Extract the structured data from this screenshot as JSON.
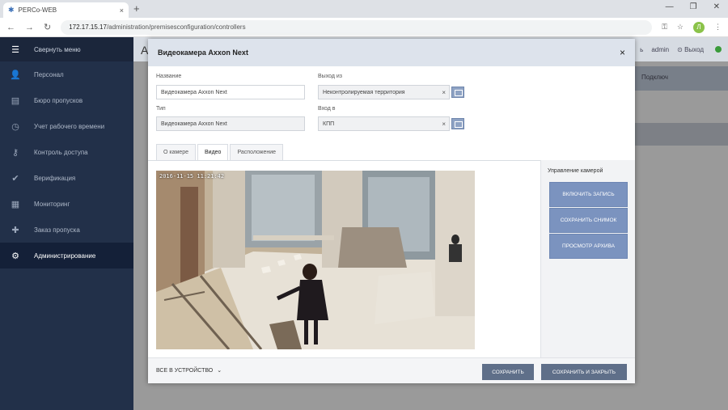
{
  "browser": {
    "tab_title": "PERCo-WEB",
    "tab_close": "×",
    "new_tab": "+",
    "url_host": "172.17.15.17",
    "url_path": "/administration/premisesconfiguration/controllers",
    "avatar_letter": "Л"
  },
  "sidebar": {
    "collapse_label": "Свернуть меню",
    "items": [
      {
        "label": "Персонал",
        "icon": "person-icon"
      },
      {
        "label": "Бюро пропусков",
        "icon": "badge-office-icon"
      },
      {
        "label": "Учет рабочего времени",
        "icon": "time-tracking-icon"
      },
      {
        "label": "Контроль доступа",
        "icon": "key-icon"
      },
      {
        "label": "Верификация",
        "icon": "verification-icon"
      },
      {
        "label": "Мониторинг",
        "icon": "monitoring-icon"
      },
      {
        "label": "Заказ пропуска",
        "icon": "pass-order-icon"
      },
      {
        "label": "Администрирование",
        "icon": "gear-icon"
      }
    ]
  },
  "background": {
    "page_letter": "А",
    "user_login": "admin",
    "logout_label": "Выход",
    "right_panel_label": "Подключ",
    "partial_text": "ь"
  },
  "modal": {
    "title": "Видеокамера Axxon Next",
    "close": "×",
    "fields": {
      "name_label": "Название",
      "name_value": "Видеокамера Axxon Next",
      "type_label": "Тип",
      "type_value": "Видеокамера Axxon Next",
      "exit_from_label": "Выход из",
      "exit_from_value": "Неконтролируемая территория",
      "entry_to_label": "Вход в",
      "entry_to_value": "КПП",
      "clear": "×"
    },
    "tabs": [
      "О камере",
      "Видео",
      "Расположение"
    ],
    "active_tab": "Видео",
    "video": {
      "timestamp": "2016-11-15 11:21:42"
    },
    "camera_control": {
      "title": "Управление камерой",
      "buttons": [
        "ВКЛЮЧИТЬ ЗАПИСЬ",
        "СОХРАНИТЬ СНИМОК",
        "ПРОСМОТР АРХИВА"
      ]
    },
    "footer": {
      "all_devices_label": "ВСЕ В УСТРОЙСТВО",
      "save_label": "СОХРАНИТЬ",
      "save_close_label": "СОХРАНИТЬ И ЗАКРЫТЬ"
    }
  },
  "colors": {
    "sidebar_bg": "#223049",
    "sidebar_active": "#142038",
    "camera_button": "#7b93bf",
    "footer_button": "#5f6f89",
    "status_online": "#3a9b3a"
  }
}
